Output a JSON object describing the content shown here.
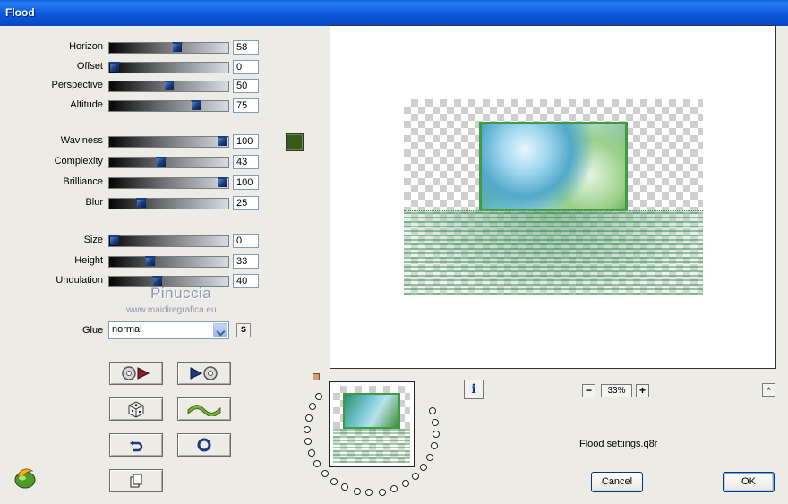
{
  "window": {
    "title": "Flood"
  },
  "sliders_group1": [
    {
      "label": "Horizon",
      "value": "58",
      "level": 58
    },
    {
      "label": "Offset",
      "value": "0",
      "level": 0
    },
    {
      "label": "Perspective",
      "value": "50",
      "level": 50
    },
    {
      "label": "Altitude",
      "value": "75",
      "level": 75
    }
  ],
  "sliders_group2": [
    {
      "label": "Waviness",
      "value": "100",
      "level": 100
    },
    {
      "label": "Complexity",
      "value": "43",
      "level": 43
    },
    {
      "label": "Brilliance",
      "value": "100",
      "level": 100
    },
    {
      "label": "Blur",
      "value": "25",
      "level": 25
    }
  ],
  "sliders_group3": [
    {
      "label": "Size",
      "value": "0",
      "level": 0
    },
    {
      "label": "Height",
      "value": "33",
      "level": 33
    },
    {
      "label": "Undulation",
      "value": "40",
      "level": 40
    }
  ],
  "color_swatch": "#3a5a1c",
  "watermark": {
    "name": "Pinuccia",
    "url": "www.maidiregrafica.eu"
  },
  "glue": {
    "label": "Glue",
    "value": "normal",
    "s_button": "S"
  },
  "icon_buttons": [
    {
      "name": "load-settings-icon"
    },
    {
      "name": "save-settings-icon"
    },
    {
      "name": "dice-random-icon"
    },
    {
      "name": "wave-icon"
    },
    {
      "name": "undo-arrow-icon"
    },
    {
      "name": "reset-circle-icon"
    },
    {
      "name": "copy-icon"
    }
  ],
  "zoom": {
    "minus": "−",
    "value": "33%",
    "plus": "+"
  },
  "info": {
    "label": "i"
  },
  "collapse": {
    "label": "^"
  },
  "settings_file": "Flood settings.q8r",
  "buttons": {
    "cancel": "Cancel",
    "ok": "OK"
  }
}
